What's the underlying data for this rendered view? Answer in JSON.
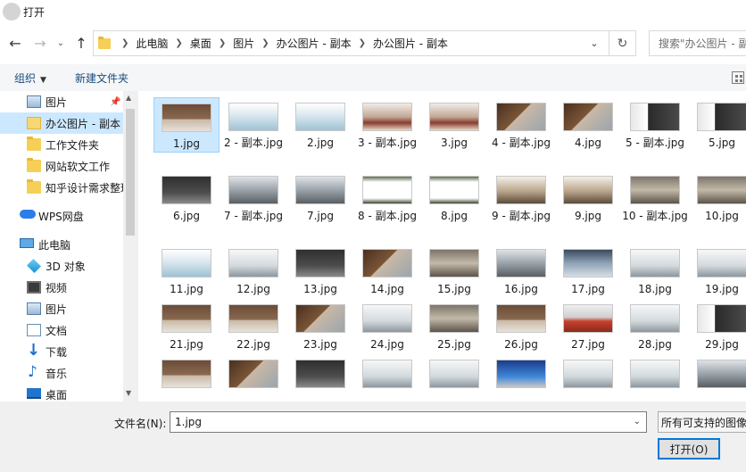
{
  "window": {
    "title": "打开"
  },
  "nav": {
    "crumbs": [
      "此电脑",
      "桌面",
      "图片",
      "办公图片 - 副本",
      "办公图片 - 副本"
    ],
    "search_placeholder": "搜索\"办公图片 - 副本\""
  },
  "toolbar": {
    "organize": "组织",
    "new_folder": "新建文件夹"
  },
  "sidebar": {
    "items": [
      {
        "label": "图片",
        "icon": "picture-icon",
        "pinned": true
      },
      {
        "label": "办公图片 - 副本",
        "icon": "folder-icon",
        "selected": true
      },
      {
        "label": "工作文件夹",
        "icon": "folder-icon"
      },
      {
        "label": "网站软文工作",
        "icon": "folder-icon"
      },
      {
        "label": "知乎设计需求整理",
        "icon": "folder-icon"
      },
      {
        "label": "WPS网盘",
        "icon": "cloud-icon"
      },
      {
        "label": "此电脑",
        "icon": "computer-icon"
      },
      {
        "label": "3D 对象",
        "icon": "3d-objects-icon"
      },
      {
        "label": "视频",
        "icon": "video-icon"
      },
      {
        "label": "图片",
        "icon": "picture-icon"
      },
      {
        "label": "文档",
        "icon": "document-icon"
      },
      {
        "label": "下载",
        "icon": "download-icon"
      },
      {
        "label": "音乐",
        "icon": "music-icon"
      },
      {
        "label": "桌面",
        "icon": "desktop-icon"
      }
    ]
  },
  "files": [
    "1.jpg",
    "2 - 副本.jpg",
    "2.jpg",
    "3 - 副本.jpg",
    "3.jpg",
    "4 - 副本.jpg",
    "4.jpg",
    "5 - 副本.jpg",
    "5.jpg",
    "6.jpg",
    "7 - 副本.jpg",
    "7.jpg",
    "8 - 副本.jpg",
    "8.jpg",
    "9 - 副本.jpg",
    "9.jpg",
    "10 - 副本.jpg",
    "10.jpg",
    "11.jpg",
    "12.jpg",
    "13.jpg",
    "14.jpg",
    "15.jpg",
    "16.jpg",
    "17.jpg",
    "18.jpg",
    "19.jpg",
    "21.jpg",
    "22.jpg",
    "23.jpg",
    "24.jpg",
    "25.jpg",
    "26.jpg",
    "27.jpg",
    "28.jpg",
    "29.jpg",
    "",
    "",
    "",
    "",
    "",
    "",
    "",
    "",
    ""
  ],
  "selected_file": "1.jpg",
  "bottom": {
    "filename_label": "文件名(N):",
    "filename_value": "1.jpg",
    "filter": "所有可支持的图像",
    "open_button": "打开(O)"
  },
  "colors": {
    "selection": "#cce8ff",
    "accent": "#0078d7",
    "folder": "#f6cf57"
  }
}
